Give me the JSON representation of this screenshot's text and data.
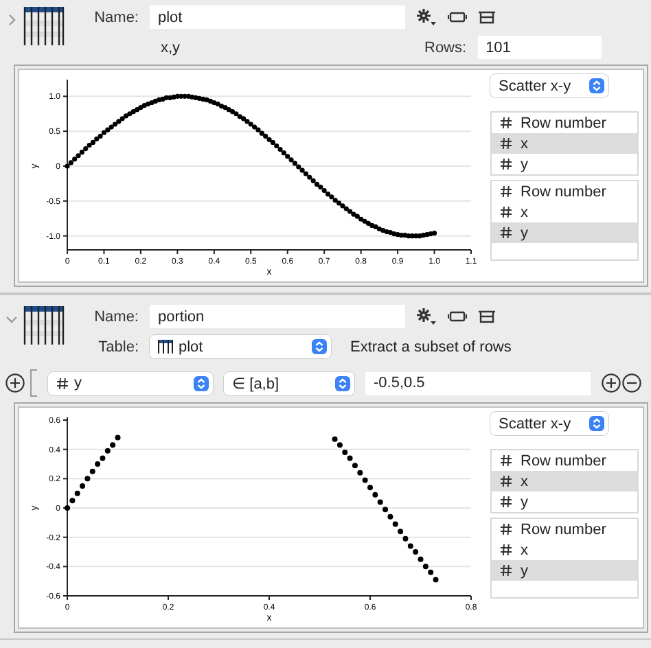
{
  "sections": [
    {
      "expanded": false,
      "name_label": "Name:",
      "name": "plot",
      "info": "x,y",
      "rows_label": "Rows:",
      "rows": "101",
      "plot": {
        "plot_type": "Scatter x-y",
        "x_columns": [
          {
            "label": "Row number",
            "selected": false
          },
          {
            "label": "x",
            "selected": true
          },
          {
            "label": "y",
            "selected": false
          }
        ],
        "y_columns": [
          {
            "label": "Row number",
            "selected": false
          },
          {
            "label": "x",
            "selected": false
          },
          {
            "label": "y",
            "selected": true
          }
        ],
        "chart_data": {
          "type": "scatter",
          "xlabel": "x",
          "ylabel": "y",
          "grid": true,
          "xlim": [
            0,
            1.1
          ],
          "ylim": [
            -1.2,
            1.2
          ],
          "xticks": [
            {
              "value": 0,
              "label": "0"
            },
            {
              "value": 0.1,
              "label": "0.1"
            },
            {
              "value": 0.2,
              "label": "0.2"
            },
            {
              "value": 0.3,
              "label": "0.3"
            },
            {
              "value": 0.4,
              "label": "0.4"
            },
            {
              "value": 0.5,
              "label": "0.5"
            },
            {
              "value": 0.6,
              "label": "0.6"
            },
            {
              "value": 0.7,
              "label": "0.7"
            },
            {
              "value": 0.8,
              "label": "0.8"
            },
            {
              "value": 0.9,
              "label": "0.9"
            },
            {
              "value": 1,
              "label": "1.0"
            },
            {
              "value": 1.1,
              "label": "1.1"
            }
          ],
          "yticks": [
            {
              "value": -1,
              "label": "-1.0"
            },
            {
              "value": -0.5,
              "label": "-0.5"
            },
            {
              "value": 0,
              "label": "0"
            },
            {
              "value": 0.5,
              "label": "0.5"
            },
            {
              "value": 1,
              "label": "1.0"
            }
          ],
          "x": [
            0,
            0.01,
            0.02,
            0.03,
            0.04,
            0.05,
            0.06,
            0.07,
            0.08,
            0.09,
            0.1,
            0.11,
            0.12,
            0.13,
            0.14,
            0.15,
            0.16,
            0.17,
            0.18,
            0.19,
            0.2,
            0.21,
            0.22,
            0.23,
            0.24,
            0.25,
            0.26,
            0.27,
            0.28,
            0.29,
            0.3,
            0.31,
            0.32,
            0.33,
            0.34,
            0.35,
            0.36,
            0.37,
            0.38,
            0.39,
            0.4,
            0.41,
            0.42,
            0.43,
            0.44,
            0.45,
            0.46,
            0.47,
            0.48,
            0.49,
            0.5,
            0.51,
            0.52,
            0.53,
            0.54,
            0.55,
            0.56,
            0.57,
            0.58,
            0.59,
            0.6,
            0.61,
            0.62,
            0.63,
            0.64,
            0.65,
            0.66,
            0.67,
            0.68,
            0.69,
            0.7,
            0.71,
            0.72,
            0.73,
            0.74,
            0.75,
            0.76,
            0.77,
            0.78,
            0.79,
            0.8,
            0.81,
            0.82,
            0.83,
            0.84,
            0.85,
            0.86,
            0.87,
            0.88,
            0.89,
            0.9,
            0.91,
            0.92,
            0.93,
            0.94,
            0.95,
            0.96,
            0.97,
            0.98,
            0.99,
            1
          ],
          "values": [
            0,
            0.05,
            0.1,
            0.15,
            0.2,
            0.25,
            0.3,
            0.34,
            0.39,
            0.43,
            0.48,
            0.52,
            0.56,
            0.6,
            0.64,
            0.68,
            0.72,
            0.75,
            0.78,
            0.81,
            0.84,
            0.87,
            0.89,
            0.91,
            0.93,
            0.95,
            0.96,
            0.98,
            0.98,
            0.99,
            1,
            1,
            1,
            1,
            0.99,
            0.98,
            0.97,
            0.96,
            0.95,
            0.93,
            0.91,
            0.89,
            0.86,
            0.84,
            0.81,
            0.78,
            0.75,
            0.71,
            0.68,
            0.64,
            0.6,
            0.56,
            0.52,
            0.47,
            0.43,
            0.38,
            0.34,
            0.29,
            0.24,
            0.19,
            0.14,
            0.09,
            0.04,
            -0.01,
            -0.06,
            -0.11,
            -0.16,
            -0.21,
            -0.26,
            -0.3,
            -0.35,
            -0.4,
            -0.44,
            -0.49,
            -0.53,
            -0.57,
            -0.61,
            -0.65,
            -0.69,
            -0.72,
            -0.76,
            -0.79,
            -0.82,
            -0.85,
            -0.87,
            -0.9,
            -0.92,
            -0.94,
            -0.95,
            -0.97,
            -0.98,
            -0.99,
            -0.99,
            -1,
            -1,
            -1,
            -1,
            -0.99,
            -0.98,
            -0.97,
            -0.96
          ]
        }
      }
    },
    {
      "expanded": true,
      "name_label": "Name:",
      "name": "portion",
      "table_label": "Table:",
      "table": "plot",
      "description": "Extract a subset of rows",
      "filter": {
        "column": "y",
        "condition": "∈ [a,b]",
        "value": "-0.5,0.5"
      },
      "plot": {
        "plot_type": "Scatter x-y",
        "x_columns": [
          {
            "label": "Row number",
            "selected": false
          },
          {
            "label": "x",
            "selected": true
          },
          {
            "label": "y",
            "selected": false
          }
        ],
        "y_columns": [
          {
            "label": "Row number",
            "selected": false
          },
          {
            "label": "x",
            "selected": false
          },
          {
            "label": "y",
            "selected": true
          }
        ],
        "chart_data": {
          "type": "scatter",
          "xlabel": "x",
          "ylabel": "y",
          "grid": true,
          "xlim": [
            0,
            0.8
          ],
          "ylim": [
            -0.6,
            0.6
          ],
          "xticks": [
            {
              "value": 0,
              "label": "0"
            },
            {
              "value": 0.2,
              "label": "0.2"
            },
            {
              "value": 0.4,
              "label": "0.4"
            },
            {
              "value": 0.6,
              "label": "0.6"
            },
            {
              "value": 0.8,
              "label": "0.8"
            }
          ],
          "yticks": [
            {
              "value": -0.6,
              "label": "-0.6"
            },
            {
              "value": -0.4,
              "label": "-0.4"
            },
            {
              "value": -0.2,
              "label": "-0.2"
            },
            {
              "value": 0,
              "label": "0"
            },
            {
              "value": 0.2,
              "label": "0.2"
            },
            {
              "value": 0.4,
              "label": "0.4"
            },
            {
              "value": 0.6,
              "label": "0.6"
            }
          ],
          "x": [
            0,
            0.01,
            0.02,
            0.03,
            0.04,
            0.05,
            0.06,
            0.07,
            0.08,
            0.09,
            0.1,
            0.53,
            0.54,
            0.55,
            0.56,
            0.57,
            0.58,
            0.59,
            0.6,
            0.61,
            0.62,
            0.63,
            0.64,
            0.65,
            0.66,
            0.67,
            0.68,
            0.69,
            0.7,
            0.71,
            0.72,
            0.73
          ],
          "values": [
            0,
            0.05,
            0.1,
            0.15,
            0.2,
            0.25,
            0.3,
            0.34,
            0.39,
            0.43,
            0.48,
            0.47,
            0.43,
            0.38,
            0.34,
            0.29,
            0.24,
            0.19,
            0.14,
            0.09,
            0.04,
            -0.01,
            -0.06,
            -0.11,
            -0.16,
            -0.21,
            -0.26,
            -0.3,
            -0.35,
            -0.4,
            -0.44,
            -0.49
          ]
        }
      }
    }
  ]
}
